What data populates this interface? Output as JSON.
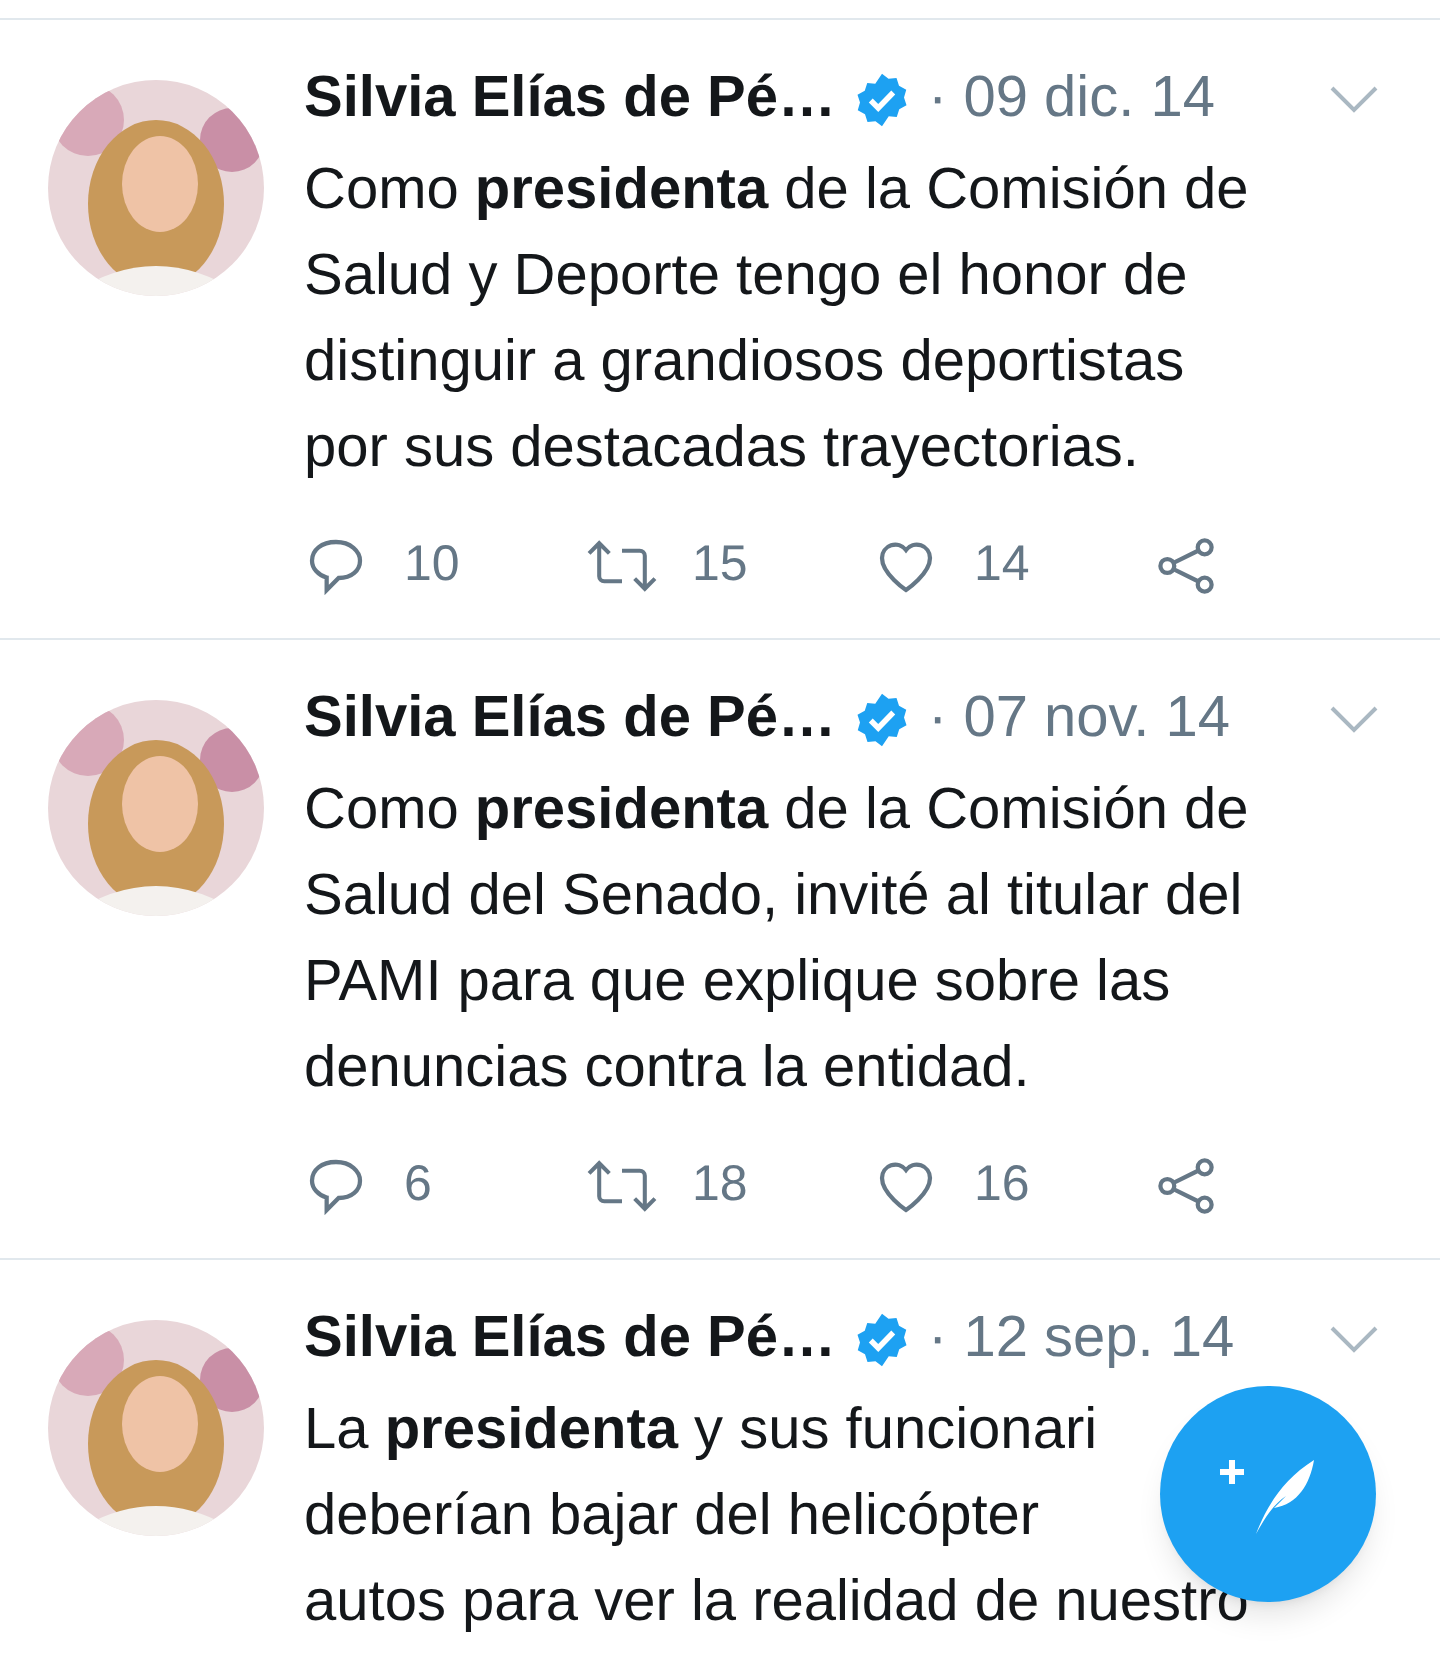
{
  "tweets": [
    {
      "name": "Silvia Elías de Pé…",
      "verified": true,
      "date": "· 09 dic. 14",
      "lines": [
        "Como **presidenta** de la Comisión de",
        "Salud y Deporte tengo el honor de",
        "distinguir a grandiosos deportistas",
        "por sus destacadas trayectorias."
      ],
      "replies": "10",
      "retweets": "15",
      "likes": "14"
    },
    {
      "name": "Silvia Elías de Pé…",
      "verified": true,
      "date": "· 07 nov. 14",
      "lines": [
        "Como **presidenta** de la Comisión de",
        "Salud del Senado, invité al titular del",
        "PAMI para que explique sobre las",
        "denuncias contra la entidad."
      ],
      "replies": "6",
      "retweets": "18",
      "likes": "16"
    },
    {
      "name": "Silvia Elías de Pé…",
      "verified": true,
      "date": "· 12 sep. 14",
      "lines": [
        "La **presidenta** y sus funcionari",
        "deberían bajar del helicópter",
        "autos para ver la realidad de nuestro"
      ]
    }
  ]
}
